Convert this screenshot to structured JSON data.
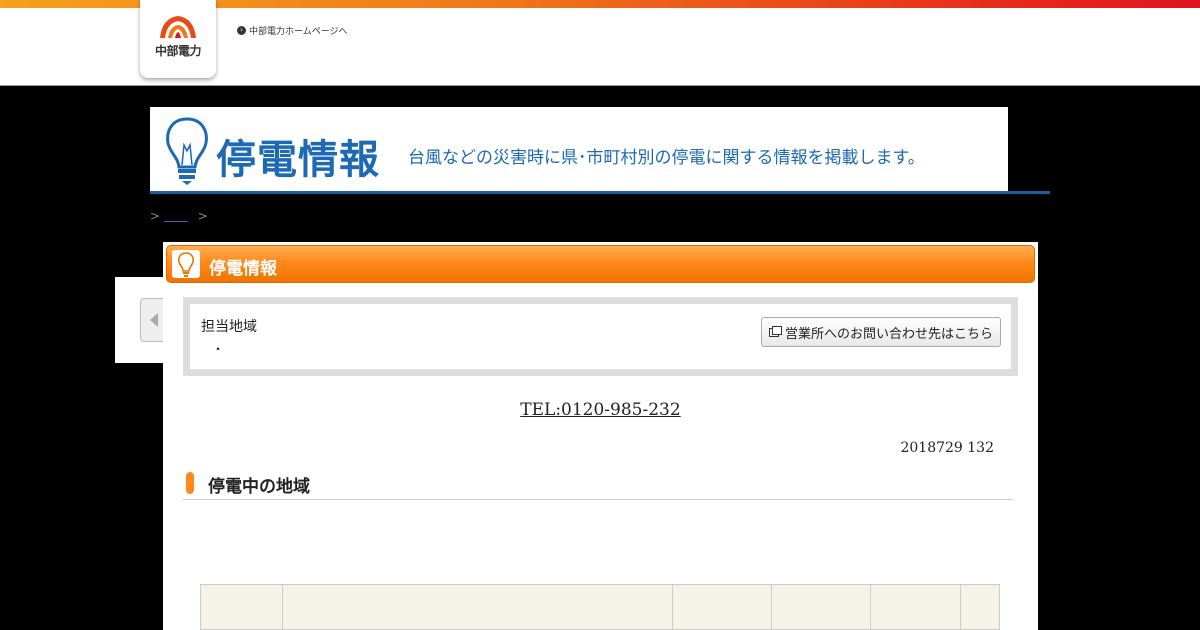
{
  "header": {
    "logo_text": "中部電力",
    "home_link": "中部電力ホームページへ"
  },
  "banner": {
    "title": "停電情報",
    "subtitle": "台風などの災害時に県･市町村別の停電に関する情報を掲載します。"
  },
  "breadcrumb": {
    "sep1": ">",
    "link": "　　",
    "sep2": ">"
  },
  "panel": {
    "title": "停電情報",
    "area_label": "担当地域",
    "area_value": "・",
    "contact_button": "営業所へのお問い合わせ先はこちら",
    "tel": "TEL:0120-985-232",
    "date": "2018729 132",
    "section_title": "停電中の地域"
  },
  "colors": {
    "accent_orange": "#ff8a1c",
    "brand_blue": "#1d69b4"
  }
}
